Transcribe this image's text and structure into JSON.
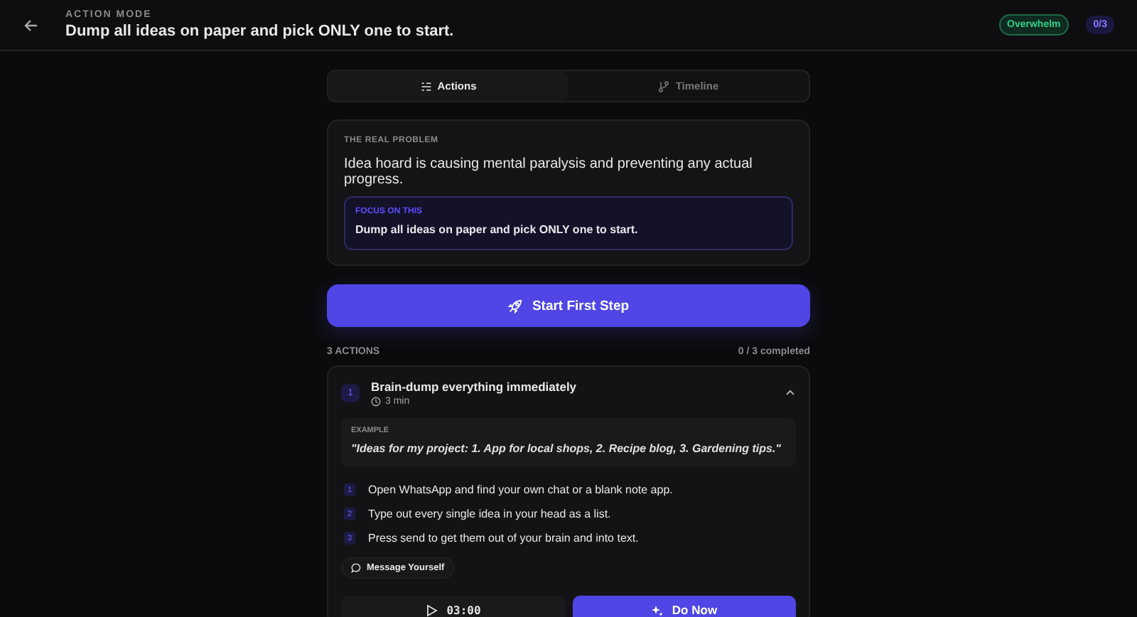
{
  "header": {
    "eyebrow": "ACTION MODE",
    "title": "Dump all ideas on paper and pick ONLY one to start.",
    "badge": "Overwhelm",
    "progress": "0/3"
  },
  "tabs": [
    {
      "label": "Actions",
      "kind": "list",
      "selected": true
    },
    {
      "label": "Timeline",
      "kind": "branch",
      "selected": false
    }
  ],
  "problem": {
    "label": "THE REAL PROBLEM",
    "text": "Idea hoard is causing mental paralysis and preventing any actual progress.",
    "focus_label": "FOCUS ON THIS",
    "focus_text": "Dump all ideas on paper and pick ONLY one to start."
  },
  "start_button": "Start First Step",
  "actions_header": {
    "count": "3 ACTIONS",
    "completed": "0 / 3 completed"
  },
  "actions": [
    {
      "number": "1",
      "title": "Brain-dump everything immediately",
      "duration": "3 min",
      "expanded": true,
      "example_label": "EXAMPLE",
      "example": "\"Ideas for my project: 1. App for local shops, 2. Recipe blog, 3. Gardening tips.\"",
      "steps": [
        {
          "number": "1",
          "text": "Open WhatsApp and find your own chat or a blank note app."
        },
        {
          "number": "2",
          "text": "Type out every single idea in your head as a list."
        },
        {
          "number": "3",
          "text": "Press send to get them out of your brain and into text."
        }
      ],
      "link": "Message Yourself",
      "timer": "03:00",
      "do_button": "Do Now"
    }
  ]
}
